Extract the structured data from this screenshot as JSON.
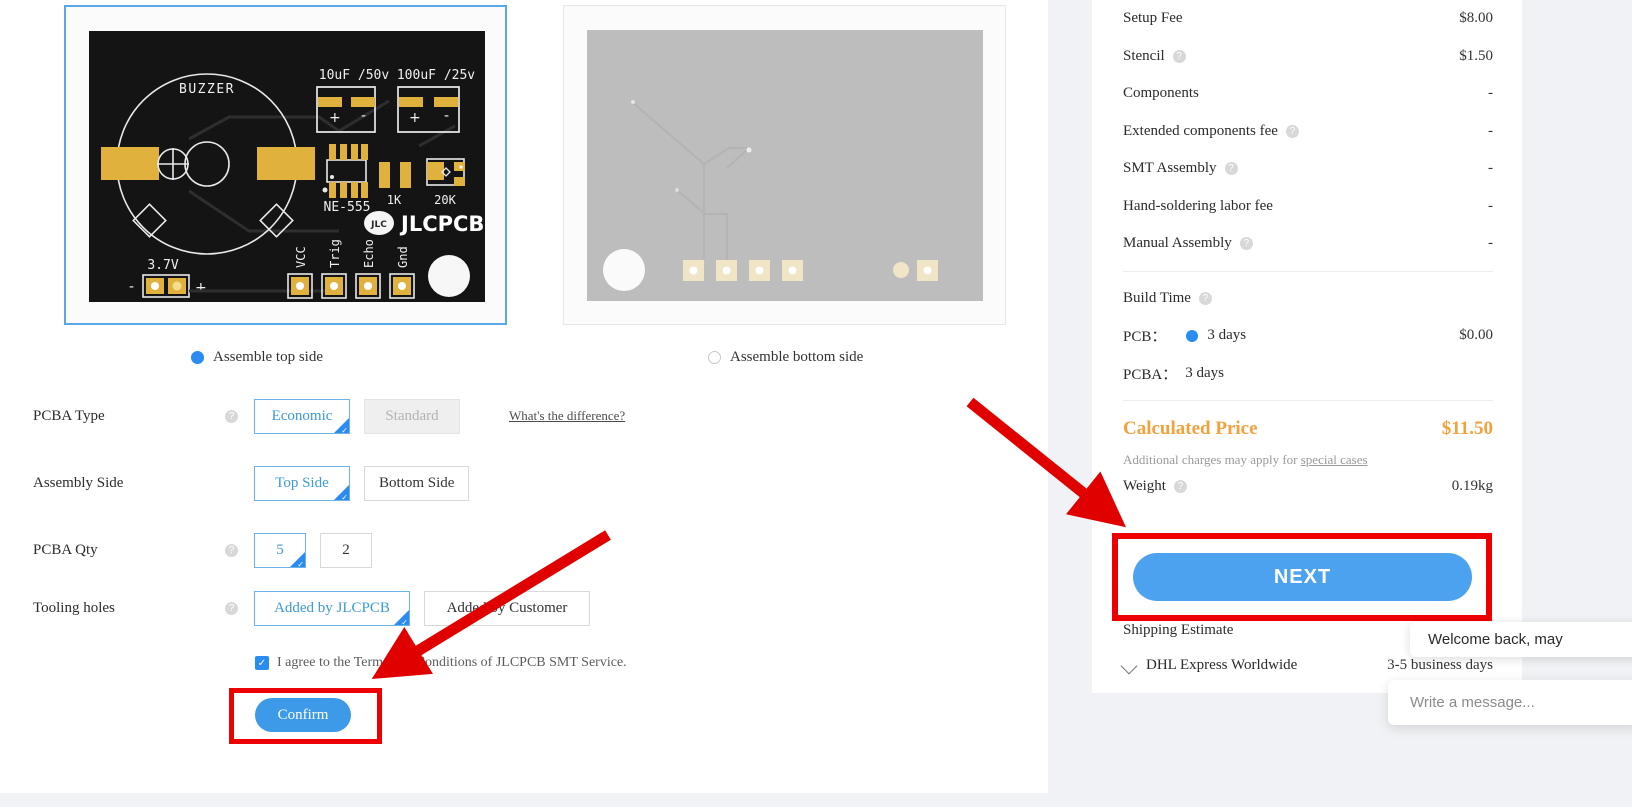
{
  "preview": {
    "top": {
      "alt": "pcb-top-render",
      "silkscreen": {
        "buzzer": "BUZZER",
        "cap1": "10uF /50v",
        "cap2": "100uF /25v",
        "ic": "NE-555",
        "r1": "1K",
        "r2": "20K",
        "logo": "JLCPCB",
        "logo_mark": "JLC",
        "power": "3.7V",
        "power_minus": "–",
        "power_plus": "+",
        "cap1_plus": "+",
        "cap1_minus": "–",
        "cap2_plus": "+",
        "cap2_minus": "–",
        "pins": [
          "VCC",
          "Trig",
          "Echo",
          "Gnd"
        ]
      }
    },
    "bottom": {
      "alt": "pcb-bottom-render"
    }
  },
  "side_radio": {
    "top": {
      "label": "Assemble top side",
      "selected": true
    },
    "bottom": {
      "label": "Assemble bottom side",
      "selected": false
    }
  },
  "form": {
    "rows": [
      {
        "label": "PCBA Type",
        "help": "?",
        "options": [
          {
            "label": "Economic",
            "state": "selected"
          },
          {
            "label": "Standard",
            "state": "disabled"
          }
        ],
        "link": "What's the difference?"
      },
      {
        "label": "Assembly Side",
        "help": "",
        "options": [
          {
            "label": "Top Side",
            "state": "selected"
          },
          {
            "label": "Bottom Side",
            "state": "normal"
          }
        ],
        "link": ""
      },
      {
        "label": "PCBA Qty",
        "help": "?",
        "options": [
          {
            "label": "5",
            "state": "selected"
          },
          {
            "label": "2",
            "state": "normal"
          }
        ],
        "link": ""
      },
      {
        "label": "Tooling holes",
        "help": "?",
        "options": [
          {
            "label": "Added by JLCPCB",
            "state": "selected"
          },
          {
            "label": "Added by Customer",
            "state": "normal"
          }
        ],
        "link": ""
      }
    ],
    "agree_text": "I agree to the Terms and Conditions of JLCPCB SMT Service.",
    "agree_checked": true,
    "agree_check_glyph": "✓",
    "confirm_label": "Confirm"
  },
  "summary": {
    "rows": [
      {
        "label": "Setup Fee",
        "help": false,
        "value": "$8.00"
      },
      {
        "label": "Stencil",
        "help": true,
        "value": "$1.50"
      },
      {
        "label": "Components",
        "help": false,
        "value": "-"
      },
      {
        "label": "Extended components fee",
        "help": true,
        "value": "-"
      },
      {
        "label": "SMT Assembly",
        "help": true,
        "value": "-"
      },
      {
        "label": "Hand-soldering labor fee",
        "help": false,
        "value": "-"
      },
      {
        "label": "Manual Assembly",
        "help": true,
        "value": "-"
      }
    ],
    "build_time": {
      "label": "Build Time",
      "help": true,
      "pcb_label": "PCB：",
      "pcb_value": "3 days",
      "pcb_price": "$0.00",
      "pcba_label": "PCBA：",
      "pcba_value": "3 days"
    },
    "calculated": {
      "label": "Calculated Price",
      "value": "$11.50",
      "color": "#f2a13c"
    },
    "note_prefix": "Additional charges may apply for ",
    "note_link": "special cases",
    "weight": {
      "label": "Weight",
      "help": true,
      "value": "0.19kg"
    },
    "next_label": "NEXT",
    "shipping": {
      "title": "Shipping Estimate",
      "carrier": "DHL Express Worldwide",
      "eta": "3-5 business days"
    }
  },
  "chat": {
    "greeting": "Welcome back, may",
    "input_placeholder": "Write a message..."
  },
  "annotations": {
    "arrow_color": "#e00000",
    "highlight_color": "#ee0000"
  },
  "help_glyph": "?"
}
